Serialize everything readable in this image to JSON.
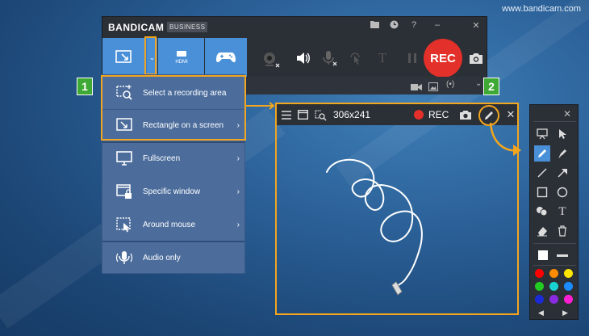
{
  "watermark": "www.bandicam.com",
  "app": {
    "logo": "BANDICAM",
    "badge": "BUSINESS",
    "titlebar_icons": [
      "folder-icon",
      "clock-icon",
      "help-icon",
      "minimize-icon",
      "close-icon"
    ],
    "rec_label": "REC",
    "modes": [
      "screen-mode",
      "hdmi-mode",
      "game-mode"
    ],
    "hdmi_label": "HDMI"
  },
  "menu": {
    "items": [
      {
        "label": "Select a recording area",
        "icon": "select-area-icon",
        "arrow": ""
      },
      {
        "label": "Rectangle on a screen",
        "icon": "rectangle-icon",
        "arrow": "›"
      },
      {
        "label": "Fullscreen",
        "icon": "monitor-icon",
        "arrow": "›"
      },
      {
        "label": "Specific window",
        "icon": "window-lock-icon",
        "arrow": "›"
      },
      {
        "label": "Around mouse",
        "icon": "around-mouse-icon",
        "arrow": "›"
      },
      {
        "label": "Audio only",
        "icon": "audio-icon",
        "arrow": ""
      }
    ]
  },
  "steps": {
    "one": "1",
    "two": "2"
  },
  "recording_area": {
    "size": "306x241",
    "rec_label": "REC"
  },
  "palette": {
    "colors": [
      "#ffffff",
      "#ff0000",
      "#ff8c00",
      "#ffe600",
      "#22cc22",
      "#19d3d3",
      "#1a8cff",
      "#1a2bd6",
      "#8a2be2",
      "#ff1fd2"
    ]
  }
}
